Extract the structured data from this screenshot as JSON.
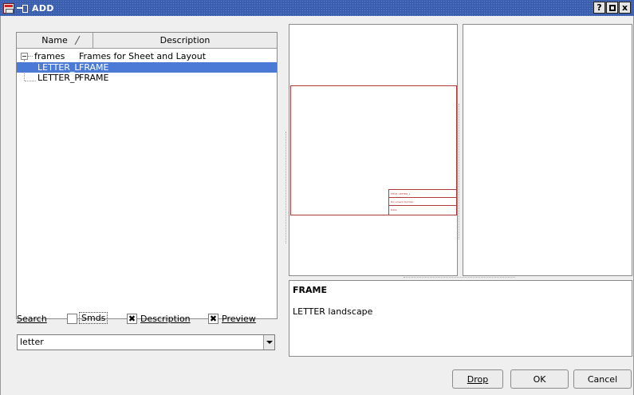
{
  "window": {
    "title": "ADD",
    "buttons": {
      "help": "?",
      "close": "x"
    }
  },
  "tree": {
    "columns": {
      "name": "Name",
      "description": "Description"
    },
    "rows": [
      {
        "name": "frames",
        "description": "Frames for Sheet and Layout"
      },
      {
        "name": "LETTER_L",
        "description": "FRAME"
      },
      {
        "name": "LETTER_P",
        "description": "FRAME"
      }
    ],
    "selected": "LETTER_L"
  },
  "search": {
    "label": "Search",
    "smds": {
      "label": "Smds",
      "checked": false
    },
    "description": {
      "label": "Description",
      "checked": true
    },
    "preview": {
      "label": "Preview",
      "checked": true
    },
    "value": "letter",
    "check_mark": "✖"
  },
  "preview": {
    "titleblock": {
      "line1": "TITLE: LETTER_L",
      "line2": "Document Number:",
      "line3": "Date:"
    }
  },
  "info": {
    "title": "FRAME",
    "description": "LETTER landscape"
  },
  "buttons": {
    "drop": "Drop",
    "ok": "OK",
    "cancel": "Cancel"
  }
}
